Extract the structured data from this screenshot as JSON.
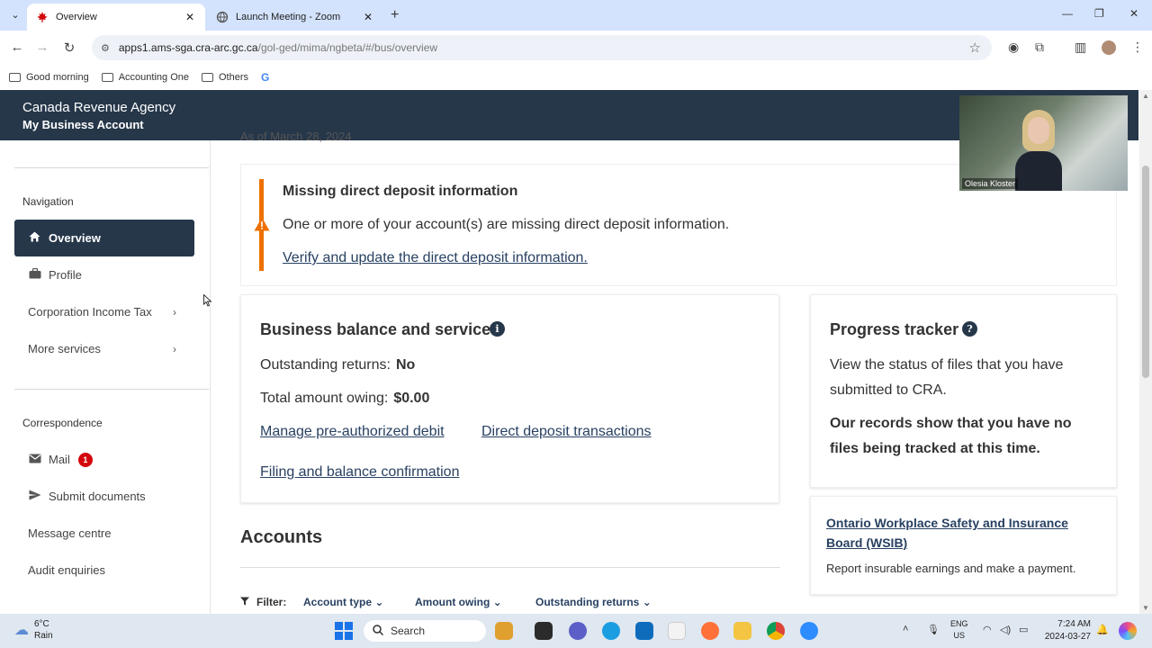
{
  "browser": {
    "tabs": [
      {
        "title": "Overview",
        "active": true
      },
      {
        "title": "Launch Meeting - Zoom",
        "active": false
      }
    ],
    "url_host": "apps1.ams-sga.cra-arc.gc.ca",
    "url_path": "/gol-ged/mima/ngbeta/#/bus/overview",
    "bookmarks": [
      "Good morning",
      "Accounting One",
      "Others"
    ]
  },
  "header": {
    "agency": "Canada Revenue Agency",
    "account": "My Business Account"
  },
  "video": {
    "participant_name": "Olesia Kloster"
  },
  "sidebar": {
    "navigation_heading": "Navigation",
    "nav_items": [
      {
        "label": "Overview",
        "icon": "home-icon",
        "active": true
      },
      {
        "label": "Profile",
        "icon": "briefcase-icon"
      },
      {
        "label": "Corporation Income Tax",
        "has_chevron": true
      },
      {
        "label": "More services",
        "has_chevron": true
      }
    ],
    "correspondence_heading": "Correspondence",
    "corr_items": [
      {
        "label": "Mail",
        "icon": "mail-icon",
        "badge": "1"
      },
      {
        "label": "Submit documents",
        "icon": "send-icon"
      },
      {
        "label": "Message centre"
      },
      {
        "label": "Audit enquiries"
      }
    ]
  },
  "main": {
    "as_of_text": "As of March 28, 2024",
    "alert": {
      "title": "Missing direct deposit information",
      "text": "One or more of your account(s) are missing direct deposit information.",
      "link": "Verify and update the direct deposit information.",
      "color": "#ee7100"
    },
    "balance": {
      "title": "Business balance and services",
      "outstanding_label": "Outstanding returns:",
      "outstanding_value": "No",
      "owing_label": "Total amount owing:",
      "owing_value": "$0.00",
      "links": [
        "Manage pre-authorized debit",
        "Direct deposit transactions",
        "Filing and balance confirmation"
      ]
    },
    "progress": {
      "title": "Progress tracker",
      "text": "View the status of files that you have submitted to CRA.",
      "bold_text": "Our records show that you have no files being tracked at this time."
    },
    "wsib": {
      "link": "Ontario Workplace Safety and Insurance Board (WSIB)",
      "text": "Report insurable earnings and make a payment."
    },
    "accounts": {
      "title": "Accounts",
      "filter_label": "Filter:",
      "filters": [
        "Account type",
        "Amount owing",
        "Outstanding returns"
      ]
    }
  },
  "taskbar": {
    "temperature": "6°C",
    "weather": "Rain",
    "search": "Search",
    "lang1": "ENG",
    "lang2": "US",
    "time": "7:24 AM",
    "date": "2024-03-27"
  },
  "colors": {
    "header_bg": "#26374a",
    "link": "#284162",
    "badge": "#d3080c"
  }
}
